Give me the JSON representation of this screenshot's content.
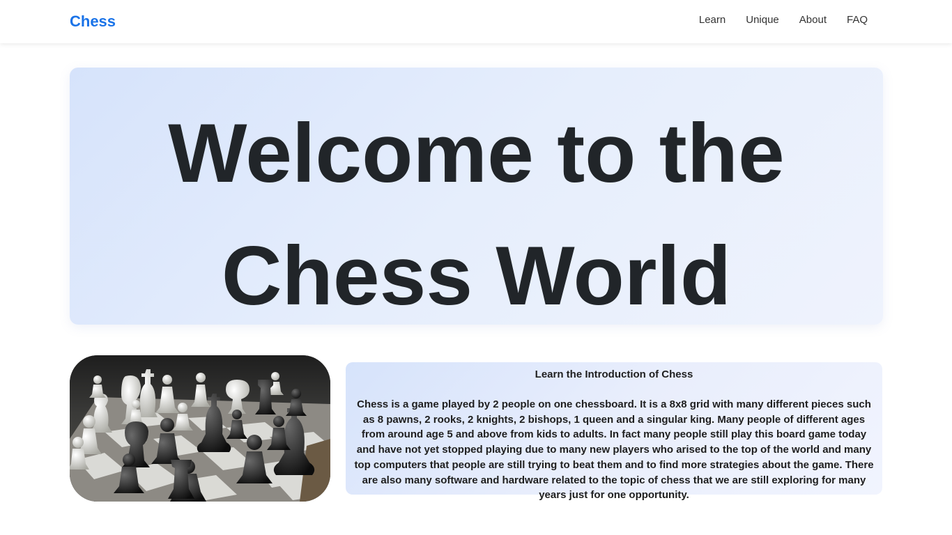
{
  "nav": {
    "brand": "Chess",
    "links": [
      "Learn",
      "Unique",
      "About",
      "FAQ"
    ]
  },
  "hero": {
    "title_line1": "Welcome to the",
    "title_line2": "Chess World"
  },
  "intro": {
    "title": "Learn the Introduction of Chess",
    "body": "Chess is a game played by 2 people on one chessboard. It is a 8x8 grid with many different pieces such as 8 pawns, 2 rooks, 2 knights, 2 bishops, 1 queen and a singular king. Many people of different ages from around age 5 and above from kids to adults. In fact many people still play this board game today and have not yet stopped playing due to many new players who arised to the top of the world and many top computers that people are still trying to beat them and to find more strategies about the game. There are also many software and hardware related to the topic of chess that we are still exploring for many years just for one opportunity."
  },
  "colors": {
    "brand": "#1a73e8",
    "text": "#212529",
    "hero_gradient_start": "#d6e3fb",
    "hero_gradient_end": "#eff3fd"
  },
  "image": {
    "subject": "chessboard-with-black-and-white-pieces"
  }
}
